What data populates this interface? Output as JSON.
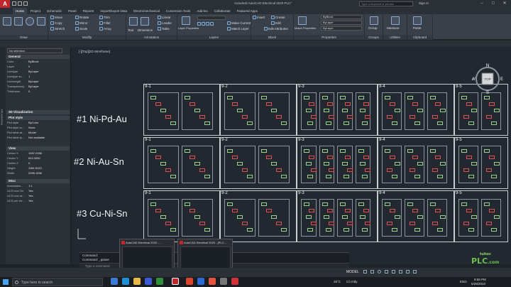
{
  "title": {
    "app_button": "A",
    "text": "Autodesk AutoCAD Electrical 2020   PLC*",
    "search_placeholder": "Type a keyword or phrase",
    "signin": "Sign In"
  },
  "tabs": [
    "Home",
    "Project",
    "Schematic",
    "Panel",
    "Reports",
    "Import/Export Data",
    "Electromechanical",
    "Conversion Tools",
    "Add-ins",
    "Collaborate",
    "Featured Apps"
  ],
  "ribbon": {
    "draw_panel": "Draw",
    "modify_panel": "Modify",
    "modify_items": [
      "Move",
      "Copy",
      "Stretch",
      "Rotate",
      "Mirror",
      "Scale",
      "Trim",
      "Fillet",
      "Array"
    ],
    "annotation_panel": "Annotation",
    "annotation_items": [
      "Text",
      "Dimension",
      "Linear",
      "Leader",
      "Table"
    ],
    "layers_panel": "Layers",
    "layer_props": "Layer Properties",
    "layer_items": [
      "Make Current",
      "Match Layer"
    ],
    "block_panel": "Block",
    "block_items": [
      "Insert",
      "Create",
      "Edit",
      "Edit Attributes"
    ],
    "properties_panel": "Properties",
    "match_props": "Match Properties",
    "bylayer": "ByLayer",
    "byblock": "ByBlock",
    "groups_panel": "Groups",
    "group_label": "Group",
    "utilities_panel": "Utilities",
    "measure_label": "Measure",
    "clipboard_panel": "Clipboard",
    "paste_label": "Paste"
  },
  "props": {
    "side_title": "PROPERTIES",
    "selection": "No selection",
    "sections": [
      "General",
      "3D Visualization",
      "Plot style",
      "View",
      "Misc"
    ],
    "general": [
      [
        "Color",
        "ByBlock"
      ],
      [
        "Layer",
        "0"
      ],
      [
        "Linetype",
        "ByLayer"
      ],
      [
        "Linetype sc...",
        "1"
      ],
      [
        "Lineweight",
        "ByLayer"
      ],
      [
        "Transparency",
        "ByLayer"
      ],
      [
        "Thickness",
        "0"
      ]
    ],
    "plotstyle": [
      [
        "Plot style",
        "ByColor"
      ],
      [
        "Plot style ta...",
        "None"
      ],
      [
        "Plot table at...",
        "Model"
      ],
      [
        "Plot table ty...",
        "Not available"
      ]
    ],
    "view": [
      [
        "Center X",
        "1087.2286"
      ],
      [
        "Center Y",
        "643.3282"
      ],
      [
        "Center Z",
        "0"
      ],
      [
        "Height",
        "1184.8123"
      ],
      [
        "Width",
        "2098.1836"
      ]
    ],
    "misc": [
      [
        "Annotation...",
        "1:1"
      ],
      [
        "UCS icon On",
        "Yes"
      ],
      [
        "UCS icon at...",
        "Yes"
      ],
      [
        "UCS per vie...",
        "Yes"
      ]
    ]
  },
  "viewport": {
    "label": "[-][Top][2D Wireframe]"
  },
  "rows": [
    "#1 Ni-Pd-Au",
    "#2 Ni-Au-Sn",
    "#3 Cu-Ni-Sn"
  ],
  "zones": [
    "9-1",
    "9-2",
    "9-3",
    "9-4",
    "9-5"
  ],
  "viewcube": {
    "n": "N",
    "s": "S",
    "e": "E",
    "w": "W",
    "top": "TOP",
    "wcs": "WCS"
  },
  "command": {
    "line1": "Command:",
    "line2": "Command: _qsave",
    "placeholder": "Type a command"
  },
  "thumbs": [
    {
      "title": "AutoCAD Electrical 2020 ..."
    },
    {
      "title": "AutoCAD Electrical 2020 - [PLC..."
    }
  ],
  "status": {
    "model": "MODEL",
    "tabs": [
      "Model",
      "Layout1",
      "Layout2"
    ]
  },
  "taskbar": {
    "search": "Type here to search",
    "temp": "25°C",
    "weather": "Có mây",
    "lang": "ENG",
    "time": "9:58 PM",
    "date": "5/28/2023"
  },
  "logo": {
    "top": "tuhoc",
    "main": "PLC",
    "suffix": ".com"
  },
  "colors": {
    "accent": "#c0262b",
    "canvas": "#212830",
    "logo": "#6ac04a"
  }
}
